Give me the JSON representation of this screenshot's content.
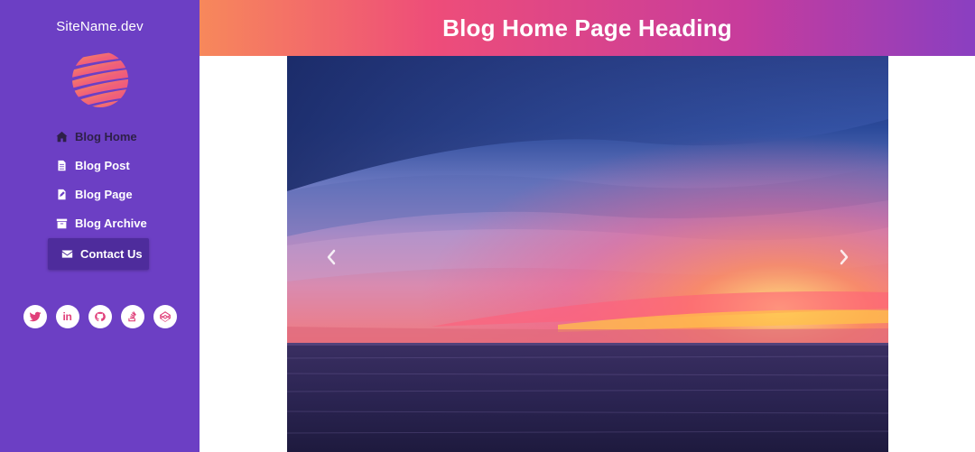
{
  "sidebar": {
    "site_name": "SiteName.dev",
    "logo_icon": "striped-globe-logo",
    "nav": [
      {
        "label": "Blog Home",
        "icon": "home-icon",
        "active": true
      },
      {
        "label": "Blog Post",
        "icon": "document-icon"
      },
      {
        "label": "Blog Page",
        "icon": "file-edit-icon"
      },
      {
        "label": "Blog Archive",
        "icon": "archive-icon"
      },
      {
        "label": "Contact Us",
        "icon": "envelope-icon",
        "highlighted": true
      }
    ],
    "socials": [
      {
        "icon": "twitter-icon"
      },
      {
        "icon": "linkedin-icon",
        "glyph": "in"
      },
      {
        "icon": "github-icon"
      },
      {
        "icon": "stackoverflow-icon"
      },
      {
        "icon": "codepen-icon"
      }
    ]
  },
  "header": {
    "title": "Blog Home Page Heading"
  },
  "carousel": {
    "slide_description_icon": "sunset-over-sea-image",
    "prev_icon": "chevron-left-icon",
    "next_icon": "chevron-right-icon"
  },
  "colors": {
    "sidebar_bg": "#6c3fc4",
    "contact_bg": "#4e2c9c",
    "header_gradient_start": "#f7885b",
    "header_gradient_mid": "#ee4d79",
    "header_gradient_end": "#8a3fc1",
    "social_icon": "#e0407a"
  }
}
